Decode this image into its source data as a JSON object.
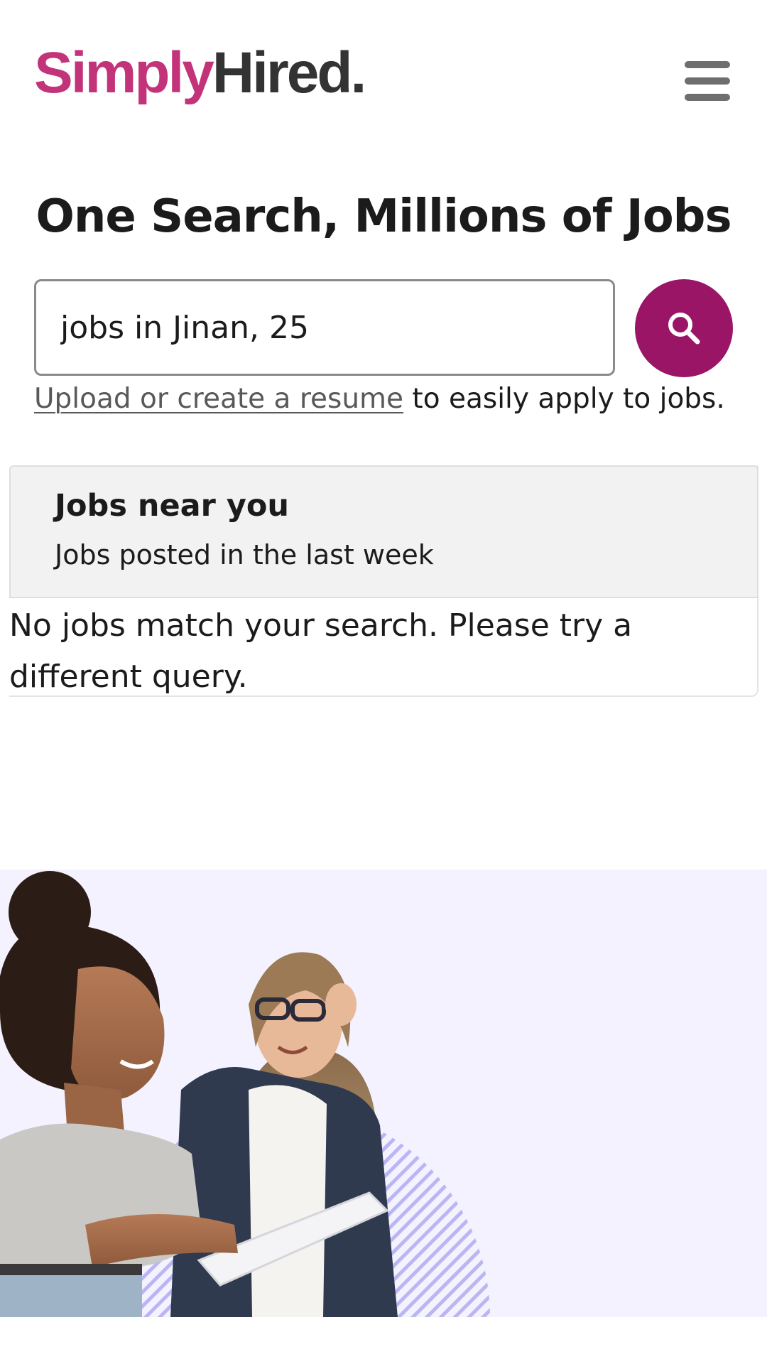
{
  "header": {
    "logo": {
      "part1": "Simply",
      "part2": "Hired",
      "part3": "."
    },
    "menu_icon": "hamburger-menu-icon"
  },
  "hero": {
    "title": "One Search, Millions of Jobs"
  },
  "search": {
    "value": "jobs in Jinan, 25",
    "icon": "search-icon"
  },
  "resume": {
    "link_text": "Upload or create a resume",
    "suffix": " to easily apply to jobs."
  },
  "jobs_near_you": {
    "title": "Jobs near you",
    "subtitle": "Jobs posted in the last week",
    "empty_message": "No jobs match your search. Please try a different query."
  },
  "colors": {
    "brand_pink": "#c2337a",
    "brand_dark": "#333333",
    "search_button": "#9b1567",
    "promo_background": "#f3f2fe",
    "hatch": "#b9b6f3"
  }
}
